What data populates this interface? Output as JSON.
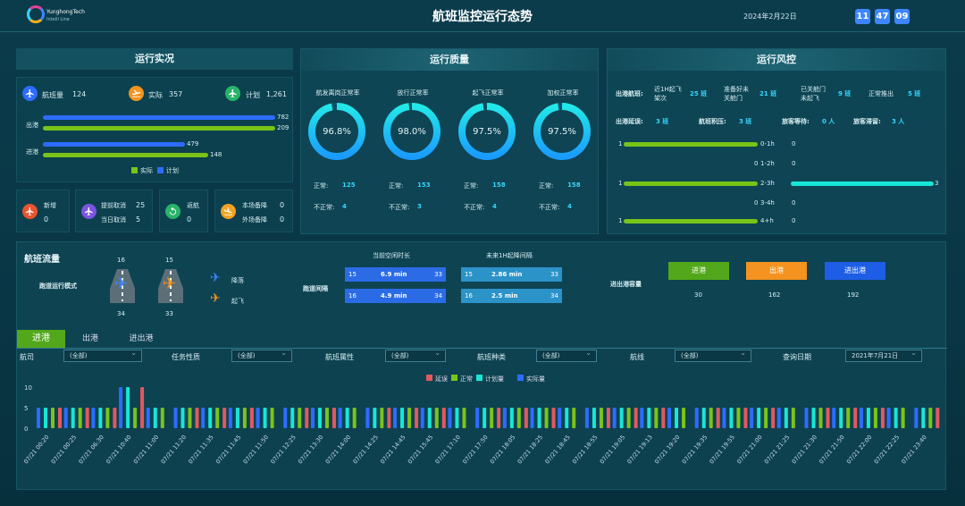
{
  "header": {
    "title": "航班监控运行态势",
    "date": "2024年2月22日 ",
    "clock": [
      "11",
      "47",
      "09"
    ],
    "logo_name": "YunghongTech",
    "logo_sub": "Intelli Line"
  },
  "colors": {
    "green": "#79c418",
    "blue": "#2d6cff",
    "teal": "#17e6d8",
    "red": "#e3585e",
    "orange": "#f4931f"
  },
  "realtime": {
    "title": "运行实况",
    "stats": [
      {
        "label": "航班量",
        "value": "124",
        "icon": "plane-icon"
      },
      {
        "label": "实际",
        "value": "357",
        "icon": "takeoff-icon"
      },
      {
        "label": "计划",
        "value": "1,261",
        "icon": "plane-icon"
      }
    ],
    "rows": [
      {
        "label": "出港",
        "plan": 782,
        "actual": 209
      },
      {
        "label": "进港",
        "plan": 479,
        "actual": 148
      }
    ],
    "legend": [
      "实际",
      "计划"
    ],
    "events": [
      {
        "l1": "新增",
        "v1": "0",
        "icon": "plane-icon"
      },
      {
        "l1": "提前取消",
        "v1": "25",
        "l2": "当日取消",
        "v2": "5",
        "icon": "cancel-icon"
      },
      {
        "l1": "返航",
        "v1": "0",
        "icon": "return-icon"
      },
      {
        "l1": "本场备降",
        "v1": "0",
        "l2": "外场备降",
        "v2": "0",
        "icon": "landing-icon"
      }
    ]
  },
  "quality": {
    "title": "运行质量",
    "items": [
      {
        "label": "航发离岗正常率",
        "pct": "96.8%",
        "pctv": 0.968,
        "normal_label": "正常:",
        "normal": "125",
        "abn_label": "不正常:",
        "abn": "4"
      },
      {
        "label": "放行正常率",
        "pct": "98.0%",
        "pctv": 0.98,
        "normal_label": "正常:",
        "normal": "153",
        "abn_label": "不正常:",
        "abn": "3"
      },
      {
        "label": "起飞正常率",
        "pct": "97.5%",
        "pctv": 0.975,
        "normal_label": "正常:",
        "normal": "158",
        "abn_label": "不正常:",
        "abn": "4"
      },
      {
        "label": "加权正常率",
        "pct": "97.5%",
        "pctv": 0.975,
        "normal_label": "正常:",
        "normal": "158",
        "abn_label": "不正常:",
        "abn": "4"
      }
    ]
  },
  "risk": {
    "title": "运行风控",
    "row1": {
      "label": "出港航班:",
      "a_l1": "近1H起飞",
      "a_l2": "架次",
      "a_v": "25 班",
      "b_l": "准备好未",
      "b_l2": "关舱门",
      "b_v": "21 班",
      "c_l": "已关舱门",
      "c_l2": "未起飞",
      "c_v": "9 班",
      "d_l": "正常推出",
      "d_v": "5 班"
    },
    "row2": [
      {
        "label": "出港延误:",
        "value": "3 班"
      },
      {
        "label": "航班积压:",
        "value": "3 班"
      },
      {
        "label": "旅客等待:",
        "value": "0 人"
      },
      {
        "label": "旅客滞留:",
        "value": "3 人"
      }
    ],
    "rows": [
      {
        "left": "1",
        "range": "0-1h",
        "right": "0",
        "lv": 1,
        "rv": 0
      },
      {
        "left": "0",
        "range": "1-2h",
        "right": "0",
        "lv": 0,
        "rv": 0
      },
      {
        "left": "1",
        "range": "2-3h",
        "right": "3",
        "lv": 1,
        "rv": 3
      },
      {
        "left": "0",
        "range": "3-4h",
        "right": "0",
        "lv": 0,
        "rv": 0
      },
      {
        "left": "1",
        "range": "4+h",
        "right": "0",
        "lv": 1,
        "rv": 0
      }
    ]
  },
  "flow": {
    "title": "航班流量",
    "mode_label": "跑道运行模式",
    "rw1_top": "16",
    "rw1_bot": "34",
    "rw2_top": "15",
    "rw2_bot": "33",
    "legend_land": "降落",
    "legend_takeoff": "起飞",
    "gap_label": "跑道间隔",
    "cur_title": "当前空闲时长",
    "next_title": "未来1H起降间隔",
    "cur": [
      {
        "l": "15",
        "v": "6.9 min",
        "r": "33"
      },
      {
        "l": "16",
        "v": "4.9 min",
        "r": "34"
      }
    ],
    "next": [
      {
        "l": "15",
        "v": "2.86 min",
        "r": "33"
      },
      {
        "l": "16",
        "v": "2.5 min",
        "r": "34"
      }
    ],
    "cap_label": "进出港容量",
    "caps": [
      {
        "label": "进港",
        "value": "30"
      },
      {
        "label": "出港",
        "value": "162"
      },
      {
        "label": "进出港",
        "value": "192"
      }
    ]
  },
  "tabs": [
    "进港",
    "出港",
    "进出港"
  ],
  "filters": [
    {
      "label": "航司",
      "value": "(全部)"
    },
    {
      "label": "任务性质",
      "value": "(全部)"
    },
    {
      "label": "航班属性",
      "value": "(全部)"
    },
    {
      "label": "航班种类",
      "value": "(全部)"
    },
    {
      "label": "航线",
      "value": "(全部)"
    },
    {
      "label": "查询日期",
      "value": "2021年7月21日"
    }
  ],
  "chart_data": {
    "type": "bar",
    "legend": [
      "延误",
      "正常",
      "计划量",
      "实际量"
    ],
    "yticks": [
      "10",
      "5",
      "0"
    ],
    "ylim": [
      0,
      10
    ],
    "groups": [
      {
        "label": "07/21 00:20",
        "red": 5,
        "green": 5,
        "teal": 5,
        "blue": 5
      },
      {
        "label": "07/21 00:25",
        "red": 5,
        "green": 5,
        "teal": 5,
        "blue": 5
      },
      {
        "label": "07/21 06:30",
        "red": 5,
        "green": 5,
        "teal": 5,
        "blue": 5
      },
      {
        "label": "07/21 10:40",
        "red": 10,
        "green": 5,
        "teal": 10,
        "blue": 10
      },
      {
        "label": "07/21 11:00",
        "red": 0,
        "green": 5,
        "teal": 5,
        "blue": 5
      },
      {
        "label": "07/21 11:20",
        "red": 5,
        "green": 5,
        "teal": 5,
        "blue": 5
      },
      {
        "label": "07/21 11:35",
        "red": 5,
        "green": 5,
        "teal": 5,
        "blue": 5
      },
      {
        "label": "07/21 11:45",
        "red": 5,
        "green": 5,
        "teal": 5,
        "blue": 5
      },
      {
        "label": "07/21 11:50",
        "red": 0,
        "green": 5,
        "teal": 5,
        "blue": 5
      },
      {
        "label": "07/21 12:25",
        "red": 5,
        "green": 5,
        "teal": 5,
        "blue": 5
      },
      {
        "label": "07/21 13:30",
        "red": 5,
        "green": 5,
        "teal": 5,
        "blue": 5
      },
      {
        "label": "07/21 14:00",
        "red": 0,
        "green": 5,
        "teal": 5,
        "blue": 5
      },
      {
        "label": "07/21 14:25",
        "red": 5,
        "green": 5,
        "teal": 5,
        "blue": 5
      },
      {
        "label": "07/21 14:45",
        "red": 5,
        "green": 5,
        "teal": 5,
        "blue": 5
      },
      {
        "label": "07/21 15:45",
        "red": 5,
        "green": 5,
        "teal": 5,
        "blue": 5
      },
      {
        "label": "07/21 17:10",
        "red": 0,
        "green": 5,
        "teal": 5,
        "blue": 5
      },
      {
        "label": "07/21 17:50",
        "red": 5,
        "green": 5,
        "teal": 5,
        "blue": 5
      },
      {
        "label": "07/21 18:05",
        "red": 5,
        "green": 5,
        "teal": 5,
        "blue": 5
      },
      {
        "label": "07/21 18:25",
        "red": 5,
        "green": 5,
        "teal": 5,
        "blue": 5
      },
      {
        "label": "07/21 18:45",
        "red": 0,
        "green": 5,
        "teal": 5,
        "blue": 5
      },
      {
        "label": "07/21 18:55",
        "red": 5,
        "green": 5,
        "teal": 5,
        "blue": 5
      },
      {
        "label": "07/21 19:05",
        "red": 5,
        "green": 5,
        "teal": 5,
        "blue": 5
      },
      {
        "label": "07/21 19:13",
        "red": 5,
        "green": 5,
        "teal": 5,
        "blue": 5
      },
      {
        "label": "07/21 19:20",
        "red": 0,
        "green": 5,
        "teal": 5,
        "blue": 5
      },
      {
        "label": "07/21 19:35",
        "red": 5,
        "green": 5,
        "teal": 5,
        "blue": 5
      },
      {
        "label": "07/21 19:55",
        "red": 5,
        "green": 5,
        "teal": 5,
        "blue": 5
      },
      {
        "label": "07/21 21:00",
        "red": 5,
        "green": 5,
        "teal": 5,
        "blue": 5
      },
      {
        "label": "07/21 21:25",
        "red": 0,
        "green": 5,
        "teal": 5,
        "blue": 5
      },
      {
        "label": "07/21 21:30",
        "red": 5,
        "green": 5,
        "teal": 5,
        "blue": 5
      },
      {
        "label": "07/21 21:50",
        "red": 5,
        "green": 5,
        "teal": 5,
        "blue": 5
      },
      {
        "label": "07/21 22:00",
        "red": 5,
        "green": 5,
        "teal": 5,
        "blue": 5
      },
      {
        "label": "07/21 22:25",
        "red": 0,
        "green": 5,
        "teal": 5,
        "blue": 5
      },
      {
        "label": "07/21 23:40",
        "red": 5,
        "green": 5,
        "teal": 5,
        "blue": 5
      }
    ]
  }
}
